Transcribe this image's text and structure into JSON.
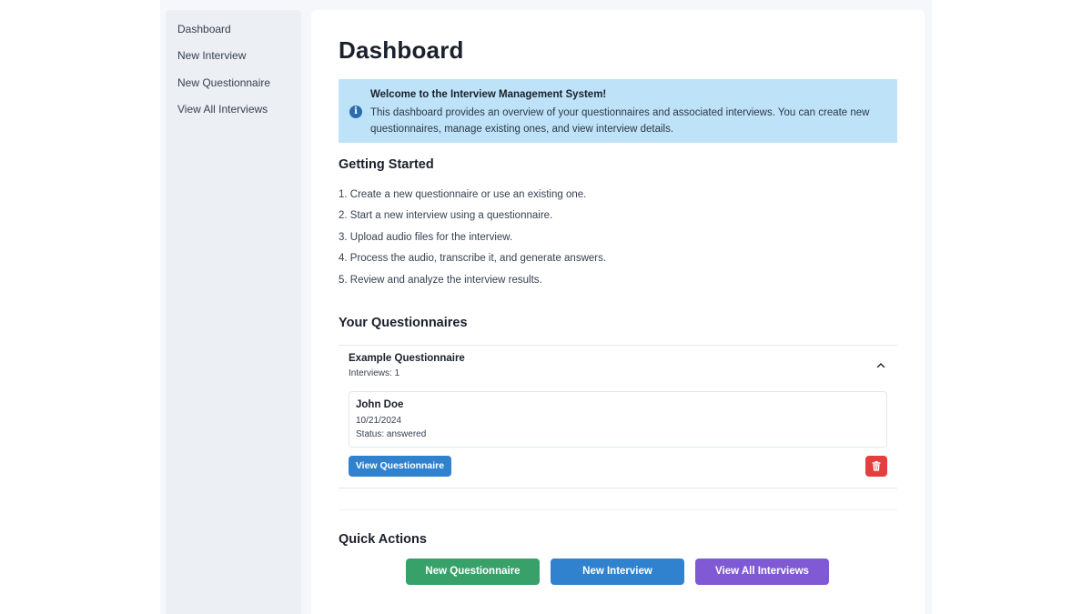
{
  "sidebar": {
    "items": [
      {
        "label": "Dashboard"
      },
      {
        "label": "New Interview"
      },
      {
        "label": "New Questionnaire"
      },
      {
        "label": "View All Interviews"
      }
    ]
  },
  "main": {
    "title": "Dashboard",
    "alert": {
      "title": "Welcome to the Interview Management System!",
      "text": "This dashboard provides an overview of your questionnaires and associated interviews. You can create new questionnaires, manage existing ones, and view interview details.",
      "icon": "info-icon",
      "color": "#bee3f8"
    },
    "getting_started": {
      "heading": "Getting Started",
      "steps": [
        "1. Create a new questionnaire or use an existing one.",
        "2. Start a new interview using a questionnaire.",
        "3. Upload audio files for the interview.",
        "4. Process the audio, transcribe it, and generate answers.",
        "5. Review and analyze the interview results."
      ]
    },
    "questionnaires": {
      "heading": "Your Questionnaires",
      "items": [
        {
          "name": "Example Questionnaire",
          "count_text": "Interviews: 1",
          "expanded_icon": "chevron-up-icon",
          "interviews": [
            {
              "name": "John Doe",
              "date": "10/21/2024",
              "status": "Status: answered"
            }
          ],
          "view_label": "View Questionnaire",
          "delete_icon": "trash-icon"
        }
      ]
    },
    "quick_actions": {
      "heading": "Quick Actions",
      "buttons": [
        {
          "label": "New Questionnaire",
          "color": "#38a169"
        },
        {
          "label": "New Interview",
          "color": "#3182ce"
        },
        {
          "label": "View All Interviews",
          "color": "#805ad5"
        }
      ]
    }
  }
}
